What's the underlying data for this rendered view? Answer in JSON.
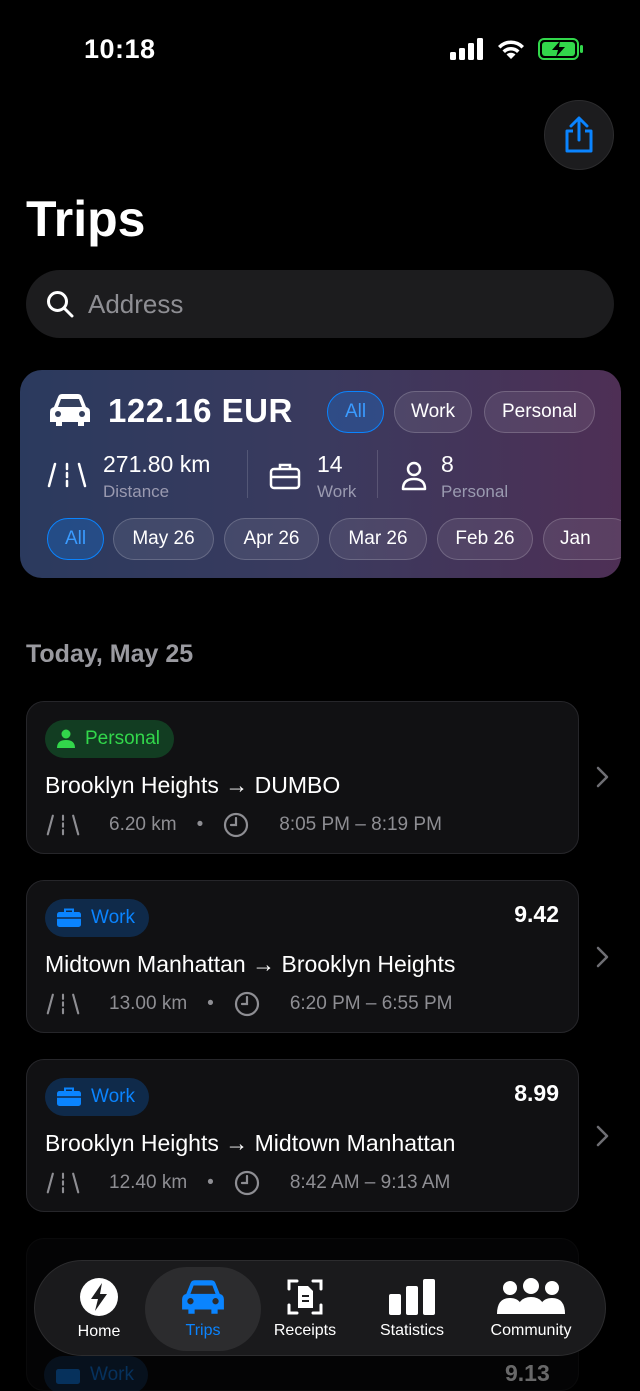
{
  "status": {
    "time": "10:18"
  },
  "title": "Trips",
  "search": {
    "placeholder": "Address"
  },
  "summary": {
    "total": "122.16 EUR",
    "filters": [
      "All",
      "Work",
      "Personal"
    ],
    "distance_value": "271.80 km",
    "distance_label": "Distance",
    "work_value": "14",
    "work_label": "Work",
    "personal_value": "8",
    "personal_label": "Personal",
    "months": [
      "All",
      "May 26",
      "Apr 26",
      "Mar 26",
      "Feb 26",
      "Jan"
    ]
  },
  "section_header": "Today, May 25",
  "trips": [
    {
      "tag": "Personal",
      "amount": "",
      "route": "Brooklyn Heights → DUMBO",
      "distance": "6.20 km",
      "time": "8:05 PM – 8:19 PM"
    },
    {
      "tag": "Work",
      "amount": "9.42",
      "route": "Midtown Manhattan → Brooklyn Heights",
      "distance": "13.00 km",
      "time": "6:20 PM – 6:55 PM"
    },
    {
      "tag": "Work",
      "amount": "8.99",
      "route": "Brooklyn Heights → Midtown Manhattan",
      "distance": "12.40 km",
      "time": "8:42 AM – 9:13 AM"
    }
  ],
  "ghost": {
    "tag": "Work",
    "amount": "9.13"
  },
  "tabs": [
    "Home",
    "Trips",
    "Receipts",
    "Statistics",
    "Community"
  ],
  "colors": {
    "accent": "#0a84ff",
    "personal": "#32d74b",
    "battery": "#32d74b"
  }
}
